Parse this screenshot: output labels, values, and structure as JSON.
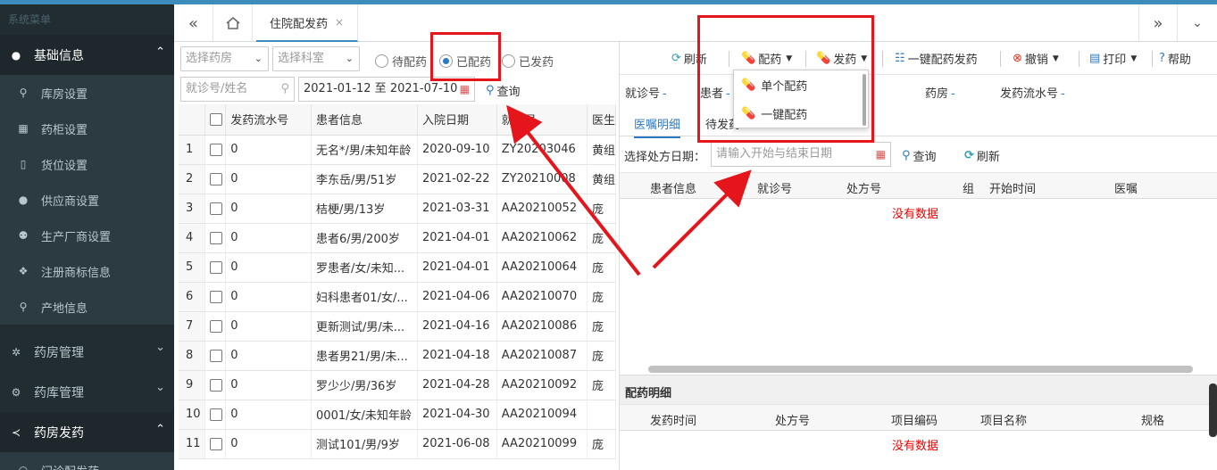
{
  "sidebar": {
    "header": "系统菜单",
    "groups": [
      {
        "label": "基础信息",
        "icon": "circle-icon",
        "expanded": true,
        "items": [
          {
            "label": "库房设置",
            "icon": "location-pin-icon"
          },
          {
            "label": "药柜设置",
            "icon": "grid-icon"
          },
          {
            "label": "货位设置",
            "icon": "columns-icon"
          },
          {
            "label": "供应商设置",
            "icon": "user-icon"
          },
          {
            "label": "生产厂商设置",
            "icon": "users-icon"
          },
          {
            "label": "注册商标信息",
            "icon": "cubes-icon"
          },
          {
            "label": "产地信息",
            "icon": "map-marker-icon"
          }
        ]
      },
      {
        "label": "药房管理",
        "icon": "gear-icon",
        "expanded": false
      },
      {
        "label": "药库管理",
        "icon": "cog-icon",
        "expanded": false
      },
      {
        "label": "药房发药",
        "icon": "share-icon",
        "expanded": true,
        "items": [
          {
            "label": "门诊配发药",
            "icon": "dot-icon"
          }
        ]
      }
    ]
  },
  "tabsbar": {
    "prev": "«",
    "home": "home-icon",
    "active_tab": "住院配发药",
    "close": "×",
    "next": "»",
    "menu": "chevron-down-icon"
  },
  "filters": {
    "pharmacy_placeholder": "选择药房",
    "department_placeholder": "选择科室",
    "radios": [
      {
        "label": "待配药",
        "checked": false
      },
      {
        "label": "已配药",
        "checked": true
      },
      {
        "label": "已发药",
        "checked": false
      }
    ],
    "search_placeholder": "就诊号/姓名",
    "date_range": "2021-01-12 至 2021-07-10",
    "query": "查询"
  },
  "patient_table": {
    "columns": [
      "发药流水号",
      "患者信息",
      "入院日期",
      "就诊号",
      "医生"
    ],
    "rows": [
      {
        "n": "1",
        "serial": "0",
        "patient": "无名*/男/未知年龄",
        "date": "2020-09-10",
        "visit": "ZY20203046",
        "doc": "黄组"
      },
      {
        "n": "2",
        "serial": "0",
        "patient": "李东岳/男/51岁",
        "date": "2021-02-22",
        "visit": "ZY20210008",
        "doc": "黄组"
      },
      {
        "n": "3",
        "serial": "0",
        "patient": "桔梗/男/13岁",
        "date": "2021-03-31",
        "visit": "AA20210052",
        "doc": "庞"
      },
      {
        "n": "4",
        "serial": "0",
        "patient": "患者6/男/200岁",
        "date": "2021-04-01",
        "visit": "AA20210062",
        "doc": "庞"
      },
      {
        "n": "5",
        "serial": "0",
        "patient": "罗患者/女/未知...",
        "date": "2021-04-01",
        "visit": "AA20210064",
        "doc": "庞"
      },
      {
        "n": "6",
        "serial": "0",
        "patient": "妇科患者01/女/...",
        "date": "2021-04-06",
        "visit": "AA20210070",
        "doc": "庞"
      },
      {
        "n": "7",
        "serial": "0",
        "patient": "更新测试/男/未...",
        "date": "2021-04-16",
        "visit": "AA20210086",
        "doc": "庞"
      },
      {
        "n": "8",
        "serial": "0",
        "patient": "患者男21/男/未...",
        "date": "2021-04-18",
        "visit": "AA20210087",
        "doc": "庞"
      },
      {
        "n": "9",
        "serial": "0",
        "patient": "罗少少/男/36岁",
        "date": "2021-04-28",
        "visit": "AA20210092",
        "doc": "庞"
      },
      {
        "n": "10",
        "serial": "0",
        "patient": "0001/女/未知年龄",
        "date": "2021-04-30",
        "visit": "AA20210094",
        "doc": ""
      },
      {
        "n": "11",
        "serial": "0",
        "patient": "测试101/男/9岁",
        "date": "2021-06-08",
        "visit": "AA20210099",
        "doc": "庞"
      }
    ]
  },
  "toolbar": {
    "refresh": "刷新",
    "dispense_prep": "配药",
    "dispense": "发药",
    "one_click": "一键配药发药",
    "undo": "撤销",
    "print": "打印",
    "help": "帮助"
  },
  "dropdown": {
    "items": [
      {
        "label": "单个配药",
        "icon": "pill-icon"
      },
      {
        "label": "一键配药",
        "icon": "multi-pill-icon"
      }
    ]
  },
  "info_bar": {
    "visit_no": "就诊号",
    "patient": "患者",
    "pharmacy": "药房",
    "serial_no": "发药流水号",
    "empty": "-"
  },
  "subtabs": {
    "orders": "医嘱明细",
    "pending": "待发药"
  },
  "prescription": {
    "date_label": "选择处方日期：",
    "date_placeholder": "请输入开始与结束日期",
    "query": "查询",
    "refresh": "刷新",
    "columns": [
      "患者信息",
      "就诊号",
      "处方号",
      "组",
      "开始时间",
      "医嘱"
    ],
    "no_data": "没有数据"
  },
  "dispense_detail": {
    "title": "配药明细",
    "columns": [
      "发药时间",
      "处方号",
      "项目编码",
      "项目名称",
      "规格"
    ],
    "no_data": "没有数据"
  },
  "colors": {
    "accent": "#2b78c5",
    "sidebar": "#222d32",
    "annotation": "#e4161b"
  }
}
